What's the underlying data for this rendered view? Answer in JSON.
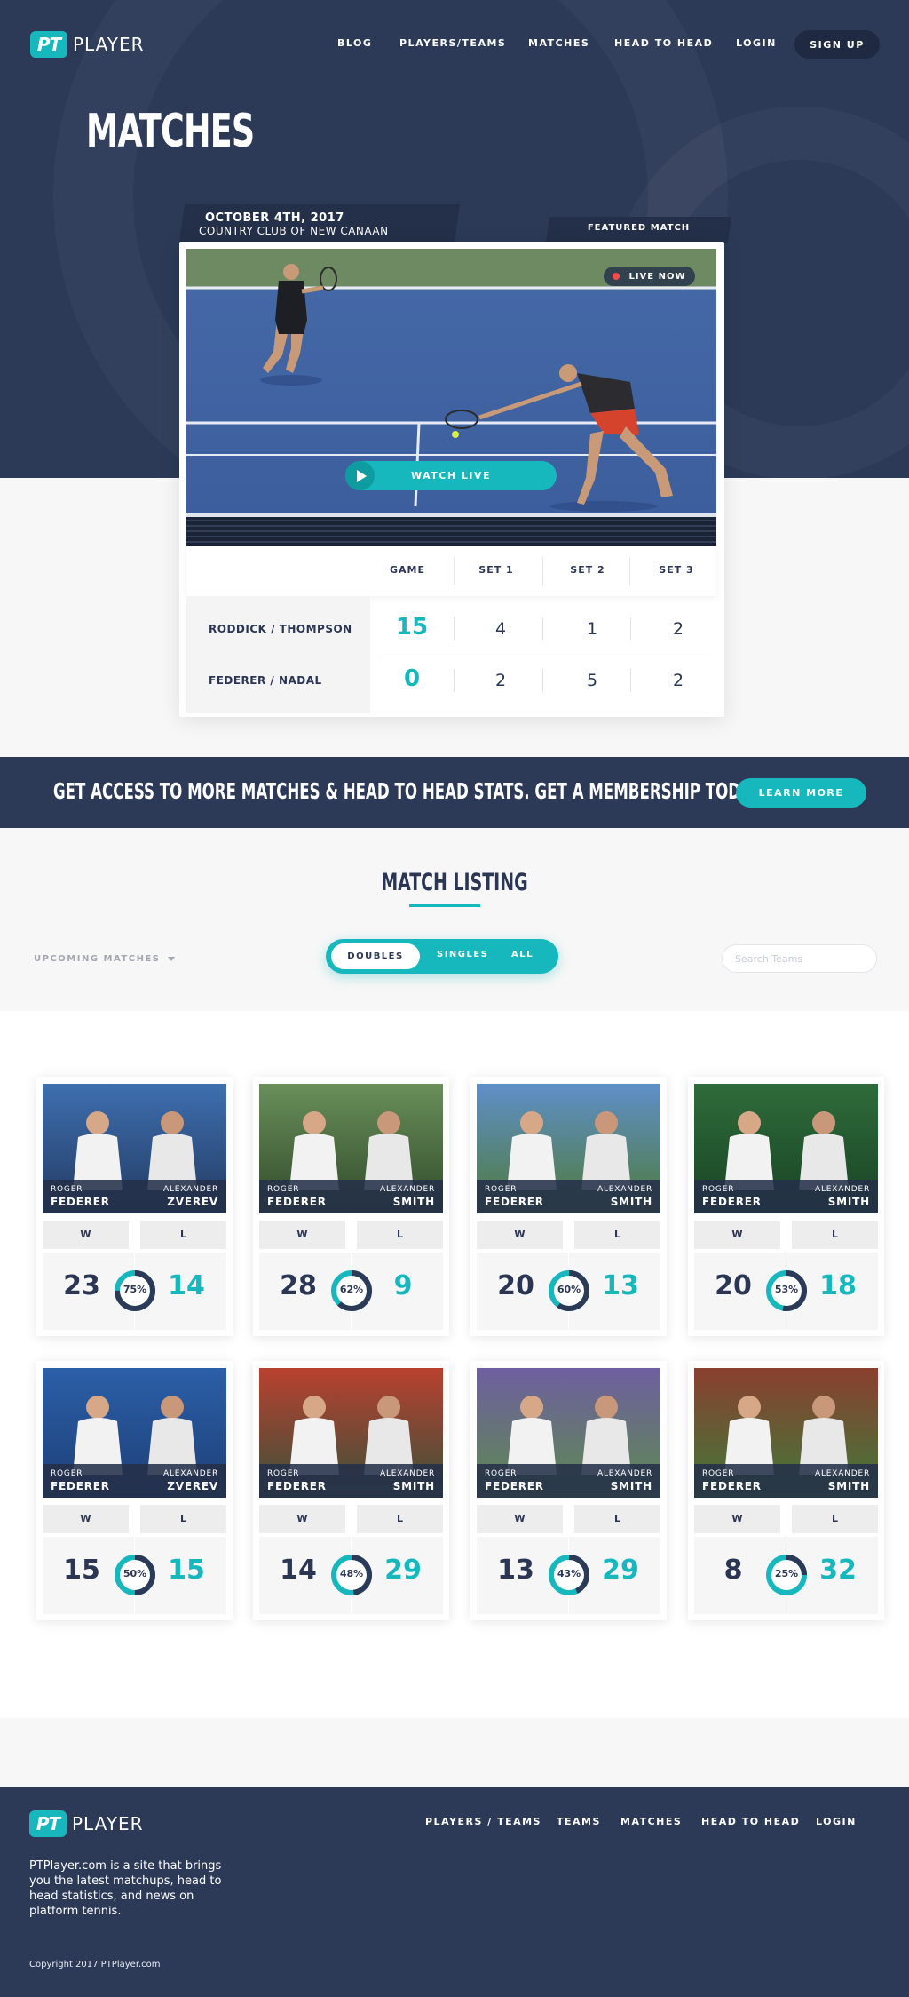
{
  "brand": {
    "mark": "PT",
    "name": "PLAYER"
  },
  "nav": {
    "items": [
      "BLOG",
      "PLAYERS/TEAMS",
      "MATCHES",
      "HEAD TO HEAD",
      "LOGIN"
    ],
    "signup": "SIGN UP"
  },
  "hero": {
    "title": "MATCHES"
  },
  "featured": {
    "date": "OCTOBER 4TH, 2017",
    "venue": "COUNTRY CLUB OF NEW CANAAN",
    "tag": "FEATURED MATCH",
    "live": "LIVE NOW",
    "watch": "WATCH LIVE",
    "columns": [
      "GAME",
      "SET 1",
      "SET 2",
      "SET 3"
    ],
    "rows": [
      {
        "team": "RODDICK / THOMPSON",
        "game": "15",
        "sets": [
          "4",
          "1",
          "2"
        ]
      },
      {
        "team": "FEDERER / NADAL",
        "game": "0",
        "sets": [
          "2",
          "5",
          "2"
        ]
      }
    ]
  },
  "banner": {
    "text": "GET ACCESS TO MORE MATCHES & HEAD TO HEAD STATS. GET A MEMBERSHIP TODAY!",
    "button": "LEARN MORE"
  },
  "listing": {
    "title": "MATCH LISTING",
    "filter": "UPCOMING MATCHES",
    "tabs": [
      "DOUBLES",
      "SINGLES",
      "ALL"
    ],
    "search_placeholder": "Search Teams",
    "w_label": "W",
    "l_label": "L",
    "cards": [
      {
        "p1_first": "ROGER",
        "p1_last": "FEDERER",
        "p2_first": "ALEXANDER",
        "p2_last": "ZVEREV",
        "wins": "23",
        "losses": "14",
        "pct": "75%",
        "pct_value": 75
      },
      {
        "p1_first": "ROGER",
        "p1_last": "FEDERER",
        "p2_first": "ALEXANDER",
        "p2_last": "SMITH",
        "wins": "28",
        "losses": "9",
        "pct": "62%",
        "pct_value": 62
      },
      {
        "p1_first": "ROGER",
        "p1_last": "FEDERER",
        "p2_first": "ALEXANDER",
        "p2_last": "SMITH",
        "wins": "20",
        "losses": "13",
        "pct": "60%",
        "pct_value": 60
      },
      {
        "p1_first": "ROGER",
        "p1_last": "FEDERER",
        "p2_first": "ALEXANDER",
        "p2_last": "SMITH",
        "wins": "20",
        "losses": "18",
        "pct": "53%",
        "pct_value": 53
      },
      {
        "p1_first": "ROGER",
        "p1_last": "FEDERER",
        "p2_first": "ALEXANDER",
        "p2_last": "ZVEREV",
        "wins": "15",
        "losses": "15",
        "pct": "50%",
        "pct_value": 50
      },
      {
        "p1_first": "ROGER",
        "p1_last": "FEDERER",
        "p2_first": "ALEXANDER",
        "p2_last": "SMITH",
        "wins": "14",
        "losses": "29",
        "pct": "48%",
        "pct_value": 48
      },
      {
        "p1_first": "ROGER",
        "p1_last": "FEDERER",
        "p2_first": "ALEXANDER",
        "p2_last": "SMITH",
        "wins": "13",
        "losses": "29",
        "pct": "43%",
        "pct_value": 43
      },
      {
        "p1_first": "ROGER",
        "p1_last": "FEDERER",
        "p2_first": "ALEXANDER",
        "p2_last": "SMITH",
        "wins": "8",
        "losses": "32",
        "pct": "25%",
        "pct_value": 25
      }
    ]
  },
  "footer": {
    "nav": [
      "PLAYERS / TEAMS",
      "TEAMS",
      "MATCHES",
      "HEAD TO HEAD",
      "LOGIN"
    ],
    "about": "PTPlayer.com is a site that brings you the latest matchups, head to head statistics, and news on platform tennis.",
    "copyright": "Copyright 2017 PTPlayer.com"
  },
  "colors": {
    "navy": "#2c3a58",
    "teal": "#17b8bd",
    "dark": "#243049"
  }
}
